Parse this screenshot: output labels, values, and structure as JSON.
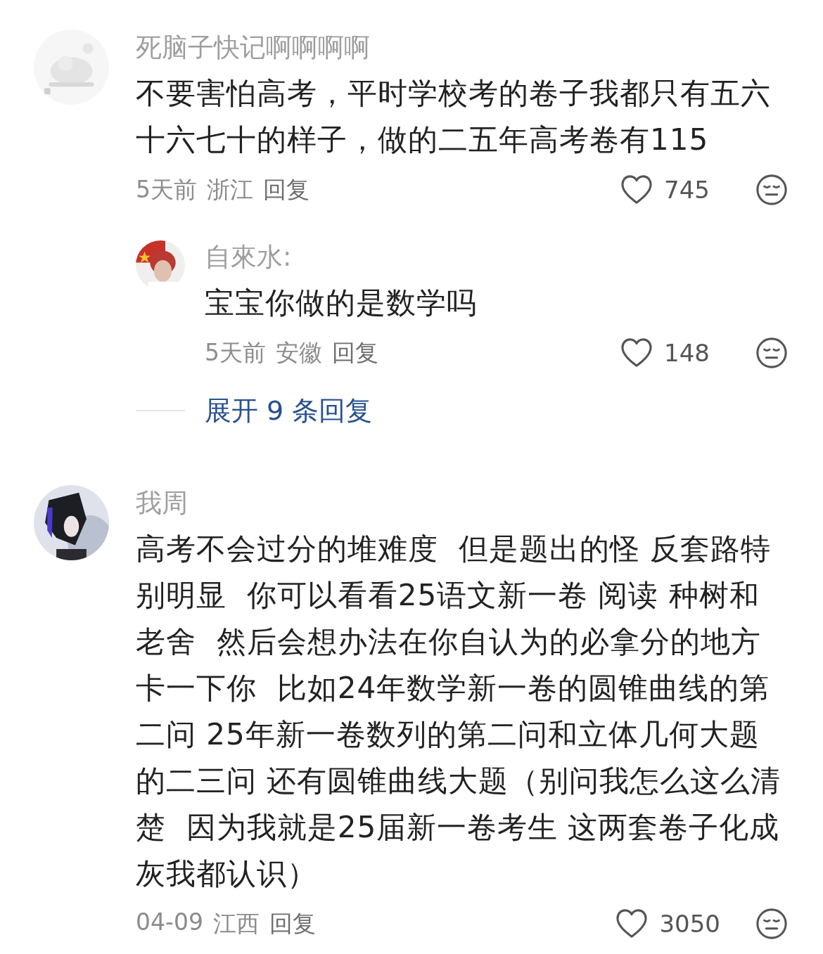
{
  "comments": [
    {
      "username": "死脑子快记啊啊啊啊",
      "text": "不要害怕高考，平时学校考的卷子我都只有五六十六七十的样子，做的二五年高考卷有115",
      "time": "5天前",
      "location": "浙江",
      "reply_label": "回复",
      "likes": "745",
      "replies": [
        {
          "username": "自來水:",
          "text": "宝宝你做的是数学吗",
          "time": "5天前",
          "location": "安徽",
          "reply_label": "回复",
          "likes": "148"
        }
      ],
      "expand_label": "展开 9 条回复"
    },
    {
      "username": "我周",
      "text": "高考不会过分的堆难度  但是题出的怪 反套路特别明显  你可以看看25语文新一卷 阅读 种树和老舍  然后会想办法在你自认为的必拿分的地方卡一下你  比如24年数学新一卷的圆锥曲线的第二问 25年新一卷数列的第二问和立体几何大题的二三问 还有圆锥曲线大题（别问我怎么这么清楚  因为我就是25届新一卷考生 这两套卷子化成灰我都认识）",
      "time": "04-09",
      "location": "江西",
      "reply_label": "回复",
      "likes": "3050"
    }
  ]
}
